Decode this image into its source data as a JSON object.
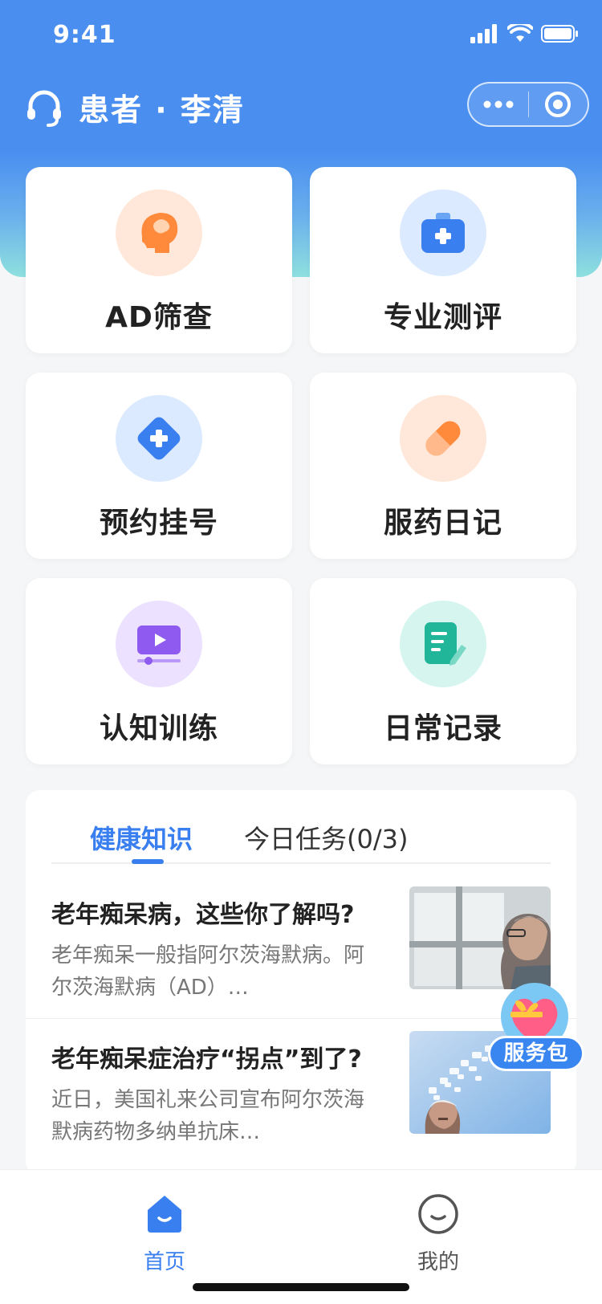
{
  "status_bar": {
    "time": "9:41"
  },
  "nav": {
    "title": "患者 · 李清",
    "icon": "headset-icon"
  },
  "menu": [
    {
      "label": "AD筛查",
      "icon": "head-brain-icon",
      "color": "#ff8a3c",
      "bg": "#ffe8d9"
    },
    {
      "label": "专业测评",
      "icon": "medical-kit-icon",
      "color": "#3a7ff0",
      "bg": "#dceaff"
    },
    {
      "label": "预约挂号",
      "icon": "plus-diamond-icon",
      "color": "#3a7ff0",
      "bg": "#dceaff"
    },
    {
      "label": "服药日记",
      "icon": "pill-icon",
      "color": "#ff8a3c",
      "bg": "#ffe8d9"
    },
    {
      "label": "认知训练",
      "icon": "video-player-icon",
      "color": "#8e5af0",
      "bg": "#ece2ff"
    },
    {
      "label": "日常记录",
      "icon": "notes-icon",
      "color": "#21b59a",
      "bg": "#d6f5ee"
    }
  ],
  "knowledge": {
    "tabs": [
      {
        "label": "健康知识",
        "active": true
      },
      {
        "label": "今日任务(0/3)",
        "active": false
      }
    ],
    "articles": [
      {
        "title": "老年痴呆病，这些你了解吗?",
        "desc": "老年痴呆一般指阿尔茨海默病。阿尔茨海默病（AD）…"
      },
      {
        "title": "老年痴呆症治疗“拐点”到了?",
        "desc": "近日，美国礼来公司宣布阿尔茨海默病药物多纳单抗床…"
      }
    ]
  },
  "fab": {
    "label": "服务包",
    "icon": "gift-heart-icon"
  },
  "tabbar": [
    {
      "label": "首页",
      "icon": "home-icon",
      "active": true
    },
    {
      "label": "我的",
      "icon": "smile-icon",
      "active": false
    }
  ],
  "colors": {
    "primary": "#3a7ff0",
    "header": "#4a8ff0",
    "accent_teal": "#8ee0df"
  }
}
